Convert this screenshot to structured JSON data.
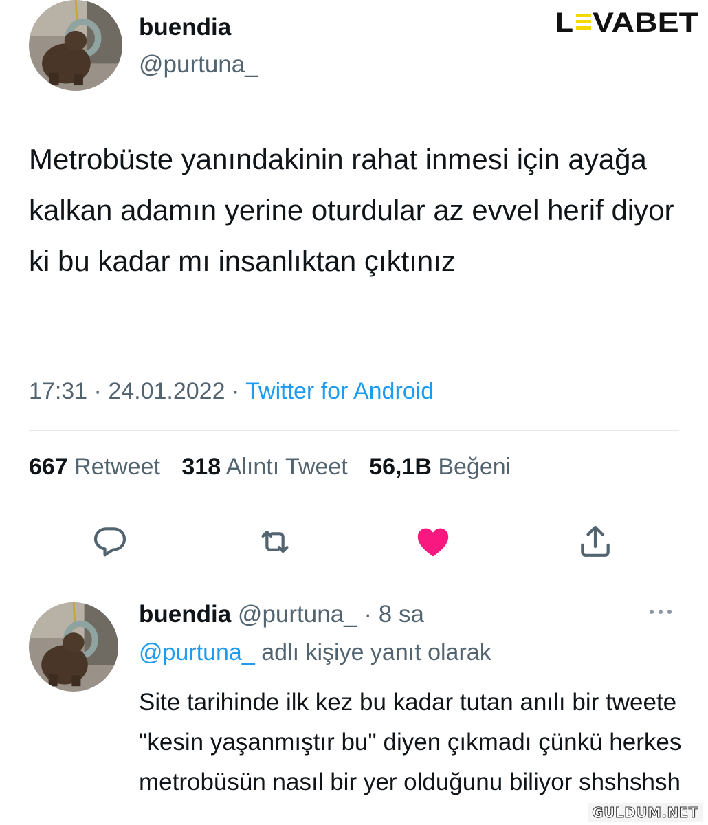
{
  "tweet": {
    "display_name": "buendia",
    "handle": "@purtuna_",
    "text": "Metrobüste yanındakinin rahat inmesi için ayağa kalkan adamın yerine oturdular az evvel herif diyor ki bu kadar mı insanlıktan çıktınız",
    "time": "17:31",
    "date": "24.01.2022",
    "separator": "·",
    "source": "Twitter for Android",
    "stats": [
      {
        "count": "667",
        "label": "Retweet"
      },
      {
        "count": "318",
        "label": "Alıntı Tweet"
      },
      {
        "count": "56,1B",
        "label": "Beğeni"
      }
    ],
    "actions": [
      {
        "name": "reply",
        "icon": "reply-icon"
      },
      {
        "name": "retweet",
        "icon": "retweet-icon"
      },
      {
        "name": "like",
        "icon": "heart-icon",
        "liked": true,
        "color": "#f91880"
      },
      {
        "name": "share",
        "icon": "share-icon"
      }
    ]
  },
  "reply": {
    "display_name": "buendia",
    "handle": "@purtuna_",
    "separator": "·",
    "time": "8 sa",
    "replying_mention": "@purtuna_",
    "replying_text": "adlı kişiye yanıt olarak",
    "text": "Site tarihinde ilk kez bu kadar tutan anılı bir tweete \"kesin yaşanmıştır bu\" diyen çıkmadı çünkü herkes metrobüsün nasıl bir yer olduğunu biliyor shshshsh"
  },
  "branding": {
    "logo_text": "LEVABET",
    "logo_accent_color": "#f5d800",
    "watermark": "GULDUM.NET"
  },
  "colors": {
    "text": "#0f1419",
    "secondary": "#536471",
    "link": "#1d9bf0",
    "like": "#f91880",
    "divider": "#e6e9ec"
  }
}
